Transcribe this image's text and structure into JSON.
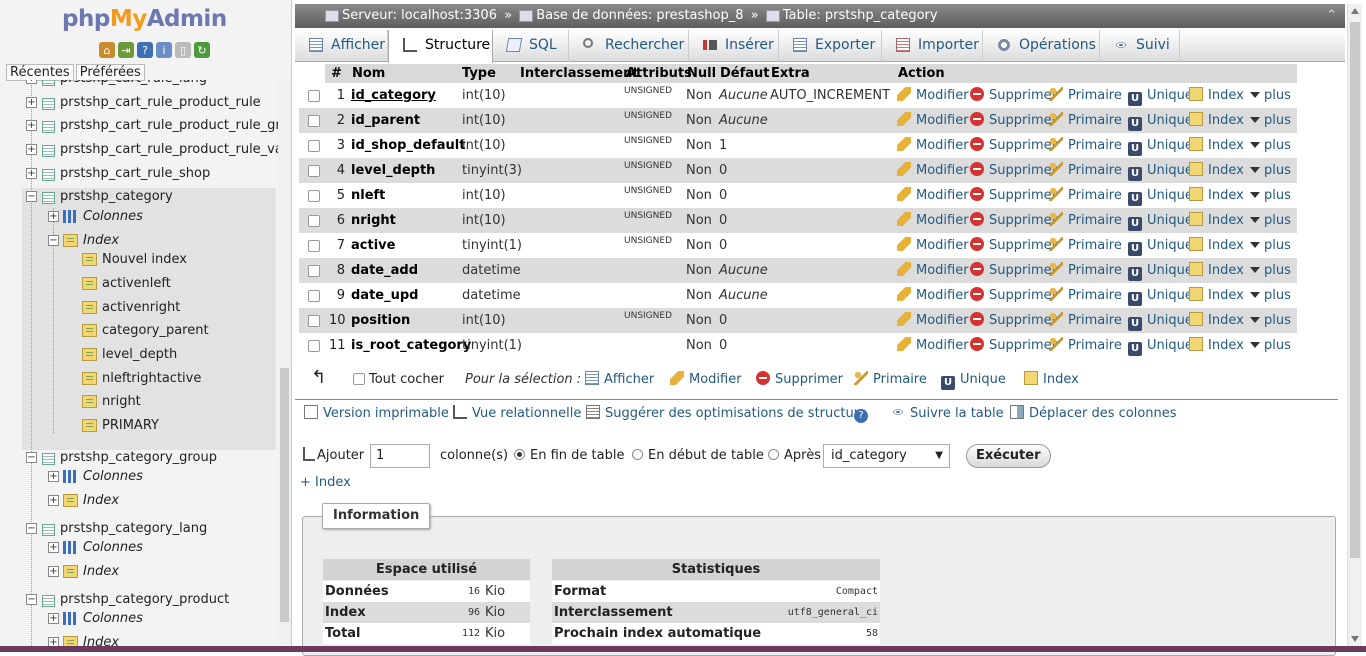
{
  "nav": {
    "logo_php": "php",
    "logo_my": "My",
    "logo_admin": "Admin",
    "tabs": [
      "Récentes",
      "Préférées"
    ],
    "tree": [
      {
        "label": "prstshp_cart_rule_lang",
        "kind": "table"
      },
      {
        "label": "prstshp_cart_rule_product_rule",
        "kind": "table"
      },
      {
        "label": "prstshp_cart_rule_product_rule_group",
        "kind": "table"
      },
      {
        "label": "prstshp_cart_rule_product_rule_value",
        "kind": "table"
      },
      {
        "label": "prstshp_cart_rule_shop",
        "kind": "table"
      },
      {
        "label": "prstshp_category",
        "kind": "table"
      },
      {
        "label": "Colonnes",
        "kind": "columns"
      },
      {
        "label": "Index",
        "kind": "index"
      },
      {
        "label": "Nouvel index",
        "kind": "idx"
      },
      {
        "label": "activenleft",
        "kind": "idx"
      },
      {
        "label": "activenright",
        "kind": "idx"
      },
      {
        "label": "category_parent",
        "kind": "idx"
      },
      {
        "label": "level_depth",
        "kind": "idx"
      },
      {
        "label": "nleftrightactive",
        "kind": "idx"
      },
      {
        "label": "nright",
        "kind": "idx"
      },
      {
        "label": "PRIMARY",
        "kind": "idx"
      },
      {
        "label": "prstshp_category_group",
        "kind": "table"
      },
      {
        "label": "Colonnes",
        "kind": "columns"
      },
      {
        "label": "Index",
        "kind": "index"
      },
      {
        "label": "prstshp_category_lang",
        "kind": "table"
      },
      {
        "label": "Colonnes",
        "kind": "columns"
      },
      {
        "label": "Index",
        "kind": "index"
      },
      {
        "label": "prstshp_category_product",
        "kind": "table"
      },
      {
        "label": "Colonnes",
        "kind": "columns"
      },
      {
        "label": "Index",
        "kind": "index"
      }
    ]
  },
  "breadcrumb": {
    "server": "Serveur: localhost:3306",
    "database": "Base de données: prestashop_8",
    "table": "Table: prstshp_category",
    "sep": "»"
  },
  "menu": [
    "Afficher",
    "Structure",
    "SQL",
    "Rechercher",
    "Insérer",
    "Exporter",
    "Importer",
    "Opérations",
    "Suivi"
  ],
  "structure": {
    "headers": [
      "#",
      "Nom",
      "Type",
      "Interclassement",
      "Attributs",
      "Null",
      "Défaut",
      "Extra",
      "Action"
    ],
    "actions": [
      "Modifier",
      "Supprimer",
      "Primaire",
      "Unique",
      "Index",
      "plus"
    ],
    "rows": [
      {
        "num": "1",
        "name": "id_category",
        "type": "int(10)",
        "attr": "UNSIGNED",
        "null": "Non",
        "default": "Aucune",
        "extra": "AUTO_INCREMENT"
      },
      {
        "num": "2",
        "name": "id_parent",
        "type": "int(10)",
        "attr": "UNSIGNED",
        "null": "Non",
        "default": "Aucune",
        "extra": ""
      },
      {
        "num": "3",
        "name": "id_shop_default",
        "type": "int(10)",
        "attr": "UNSIGNED",
        "null": "Non",
        "default": "1",
        "extra": ""
      },
      {
        "num": "4",
        "name": "level_depth",
        "type": "tinyint(3)",
        "attr": "UNSIGNED",
        "null": "Non",
        "default": "0",
        "extra": ""
      },
      {
        "num": "5",
        "name": "nleft",
        "type": "int(10)",
        "attr": "UNSIGNED",
        "null": "Non",
        "default": "0",
        "extra": ""
      },
      {
        "num": "6",
        "name": "nright",
        "type": "int(10)",
        "attr": "UNSIGNED",
        "null": "Non",
        "default": "0",
        "extra": ""
      },
      {
        "num": "7",
        "name": "active",
        "type": "tinyint(1)",
        "attr": "UNSIGNED",
        "null": "Non",
        "default": "0",
        "extra": ""
      },
      {
        "num": "8",
        "name": "date_add",
        "type": "datetime",
        "attr": "",
        "null": "Non",
        "default": "Aucune",
        "extra": ""
      },
      {
        "num": "9",
        "name": "date_upd",
        "type": "datetime",
        "attr": "",
        "null": "Non",
        "default": "Aucune",
        "extra": ""
      },
      {
        "num": "10",
        "name": "position",
        "type": "int(10)",
        "attr": "UNSIGNED",
        "null": "Non",
        "default": "0",
        "extra": ""
      },
      {
        "num": "11",
        "name": "is_root_category",
        "type": "tinyint(1)",
        "attr": "",
        "null": "Non",
        "default": "0",
        "extra": ""
      }
    ]
  },
  "selection": {
    "check_all": "Tout cocher",
    "for_selection": "Pour la sélection :",
    "actions": [
      "Afficher",
      "Modifier",
      "Supprimer",
      "Primaire",
      "Unique",
      "Index"
    ]
  },
  "links": [
    "Version imprimable",
    "Vue relationnelle",
    "Suggérer des optimisations de structure",
    "Suivre la table",
    "Déplacer des colonnes"
  ],
  "add_column": {
    "label": "Ajouter",
    "count": "1",
    "columns_label": "colonne(s)",
    "opt_end": "En fin de table",
    "opt_start": "En début de table",
    "opt_after": "Après",
    "after_value": "id_category",
    "execute": "Exécuter"
  },
  "add_index": "+ Index",
  "info": {
    "legend": "Information",
    "space": {
      "title": "Espace utilisé",
      "rows": [
        {
          "label": "Données",
          "value": "16",
          "unit": "Kio"
        },
        {
          "label": "Index",
          "value": "96",
          "unit": "Kio"
        },
        {
          "label": "Total",
          "value": "112",
          "unit": "Kio"
        }
      ]
    },
    "stats": {
      "title": "Statistiques",
      "rows": [
        {
          "label": "Format",
          "value": "Compact"
        },
        {
          "label": "Interclassement",
          "value": "utf8_general_ci"
        },
        {
          "label": "Prochain index automatique",
          "value": "58"
        }
      ]
    }
  },
  "colors": {
    "link": "#235a81",
    "row_alt": "#dcdcdc",
    "breadcrumb": "#6e6e6e"
  }
}
